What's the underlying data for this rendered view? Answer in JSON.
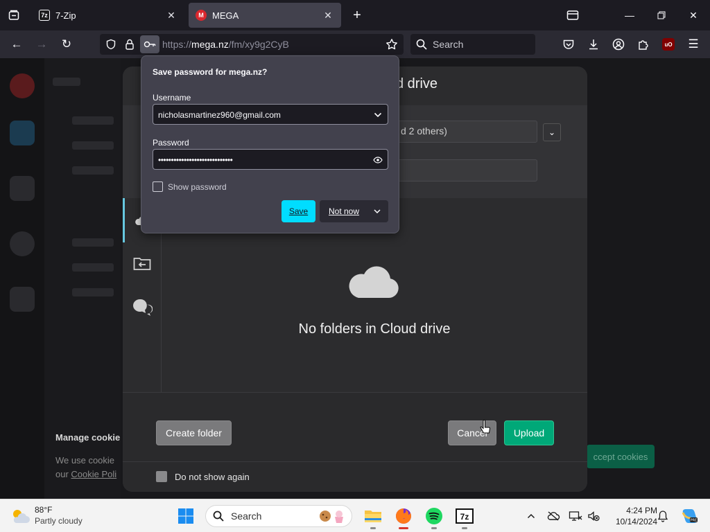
{
  "browser": {
    "tabs": [
      {
        "label": "7-Zip",
        "favicon": "7z-icon",
        "active": false
      },
      {
        "label": "MEGA",
        "favicon": "mega-icon",
        "active": true
      }
    ],
    "url_prefix": "https://",
    "url_host": "mega.nz",
    "url_path": "/fm/xy9g2CyB",
    "search_placeholder": "Search"
  },
  "password_prompt": {
    "heading": "Save password for mega.nz?",
    "username_label": "Username",
    "username_value": "nicholasmartinez960@gmail.com",
    "password_label": "Password",
    "password_masked": "•••••••••••••••••••••••••••••",
    "show_password_label": "Show password",
    "save_label": "Save",
    "not_now_label": "Not now",
    "accent": "#00ddff"
  },
  "dialog": {
    "title_fragment": "d drive",
    "recipients_fragment": "d 2 others)",
    "empty_message": "No folders in Cloud drive",
    "create_folder_label": "Create folder",
    "cancel_label": "Cancel",
    "upload_label": "Upload",
    "dont_show_label": "Do not show again",
    "upload_color": "#00a878"
  },
  "background_page": {
    "cookie_heading": "Manage cookie",
    "cookie_text": "We use cookie",
    "cookie_link_prefix": "our ",
    "cookie_link": "Cookie Poli",
    "accept_cookies_label": "ccept cookies"
  },
  "taskbar": {
    "weather_temp": "88°F",
    "weather_condition": "Partly cloudy",
    "search_placeholder": "Search",
    "time": "4:24 PM",
    "date": "10/14/2024"
  }
}
